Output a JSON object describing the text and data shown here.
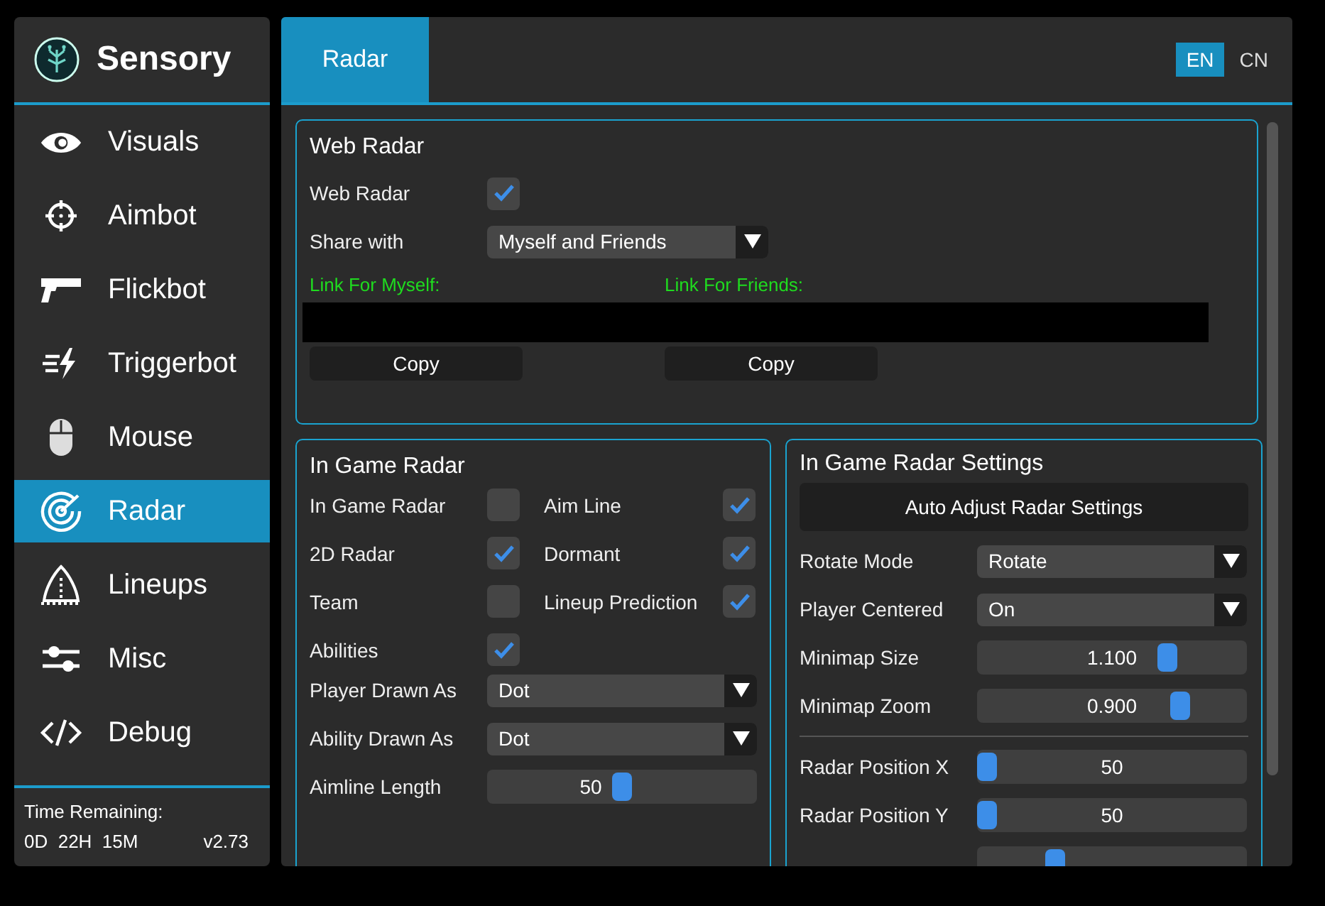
{
  "app": {
    "name": "Sensory"
  },
  "sidebar": {
    "items": [
      {
        "label": "Visuals",
        "selected": false
      },
      {
        "label": "Aimbot",
        "selected": false
      },
      {
        "label": "Flickbot",
        "selected": false
      },
      {
        "label": "Triggerbot",
        "selected": false
      },
      {
        "label": "Mouse",
        "selected": false
      },
      {
        "label": "Radar",
        "selected": true
      },
      {
        "label": "Lineups",
        "selected": false
      },
      {
        "label": "Misc",
        "selected": false
      },
      {
        "label": "Debug",
        "selected": false
      }
    ]
  },
  "footer": {
    "label": "Time Remaining:",
    "time": "0D  22H  15M",
    "version": "v2.73"
  },
  "header": {
    "tabs": [
      {
        "label": "Radar",
        "selected": true
      }
    ],
    "languages": [
      {
        "label": "EN",
        "selected": true
      },
      {
        "label": "CN",
        "selected": false
      }
    ]
  },
  "web_radar": {
    "title": "Web Radar",
    "rows": [
      {
        "kind": "checkbox",
        "label": "Web Radar",
        "checked": true
      },
      {
        "kind": "dropdown",
        "label": "Share with",
        "value": "Myself and Friends"
      }
    ],
    "links": [
      {
        "label": "Link For Myself:",
        "button": "Copy"
      },
      {
        "label": "Link For Friends:",
        "button": "Copy"
      }
    ]
  },
  "in_game_radar": {
    "title": "In Game Radar",
    "checkboxes": [
      {
        "label": "In Game Radar",
        "checked": false
      },
      {
        "label": "Aim Line",
        "checked": true
      },
      {
        "label": "2D Radar",
        "checked": true
      },
      {
        "label": "Dormant",
        "checked": true
      },
      {
        "label": "Team",
        "checked": false
      },
      {
        "label": "Lineup Prediction",
        "checked": true
      },
      {
        "label": "Abilities",
        "checked": true
      }
    ],
    "rows": [
      {
        "kind": "dropdown",
        "label": "Player Drawn As",
        "value": "Dot"
      },
      {
        "kind": "dropdown",
        "label": "Ability Drawn As",
        "value": "Dot"
      },
      {
        "kind": "slider",
        "label": "Aimline Length",
        "value": "50",
        "level": 0.5
      }
    ]
  },
  "radar_settings": {
    "title": "In Game Radar Settings",
    "button": "Auto Adjust Radar Settings",
    "rows": [
      {
        "kind": "dropdown",
        "label": "Rotate Mode",
        "value": "Rotate"
      },
      {
        "kind": "dropdown",
        "label": "Player Centered",
        "value": "On"
      },
      {
        "kind": "slider",
        "label": "Minimap Size",
        "value": "1.100",
        "level": 0.72
      },
      {
        "kind": "slider",
        "label": "Minimap Zoom",
        "value": "0.900",
        "level": 0.77
      },
      {
        "kind": "divider"
      },
      {
        "kind": "slider",
        "label": "Radar Position X",
        "value": "50",
        "level": 0
      },
      {
        "kind": "slider",
        "label": "Radar Position Y",
        "value": "50",
        "level": 0
      },
      {
        "kind": "slider",
        "level": 0.27
      }
    ]
  }
}
